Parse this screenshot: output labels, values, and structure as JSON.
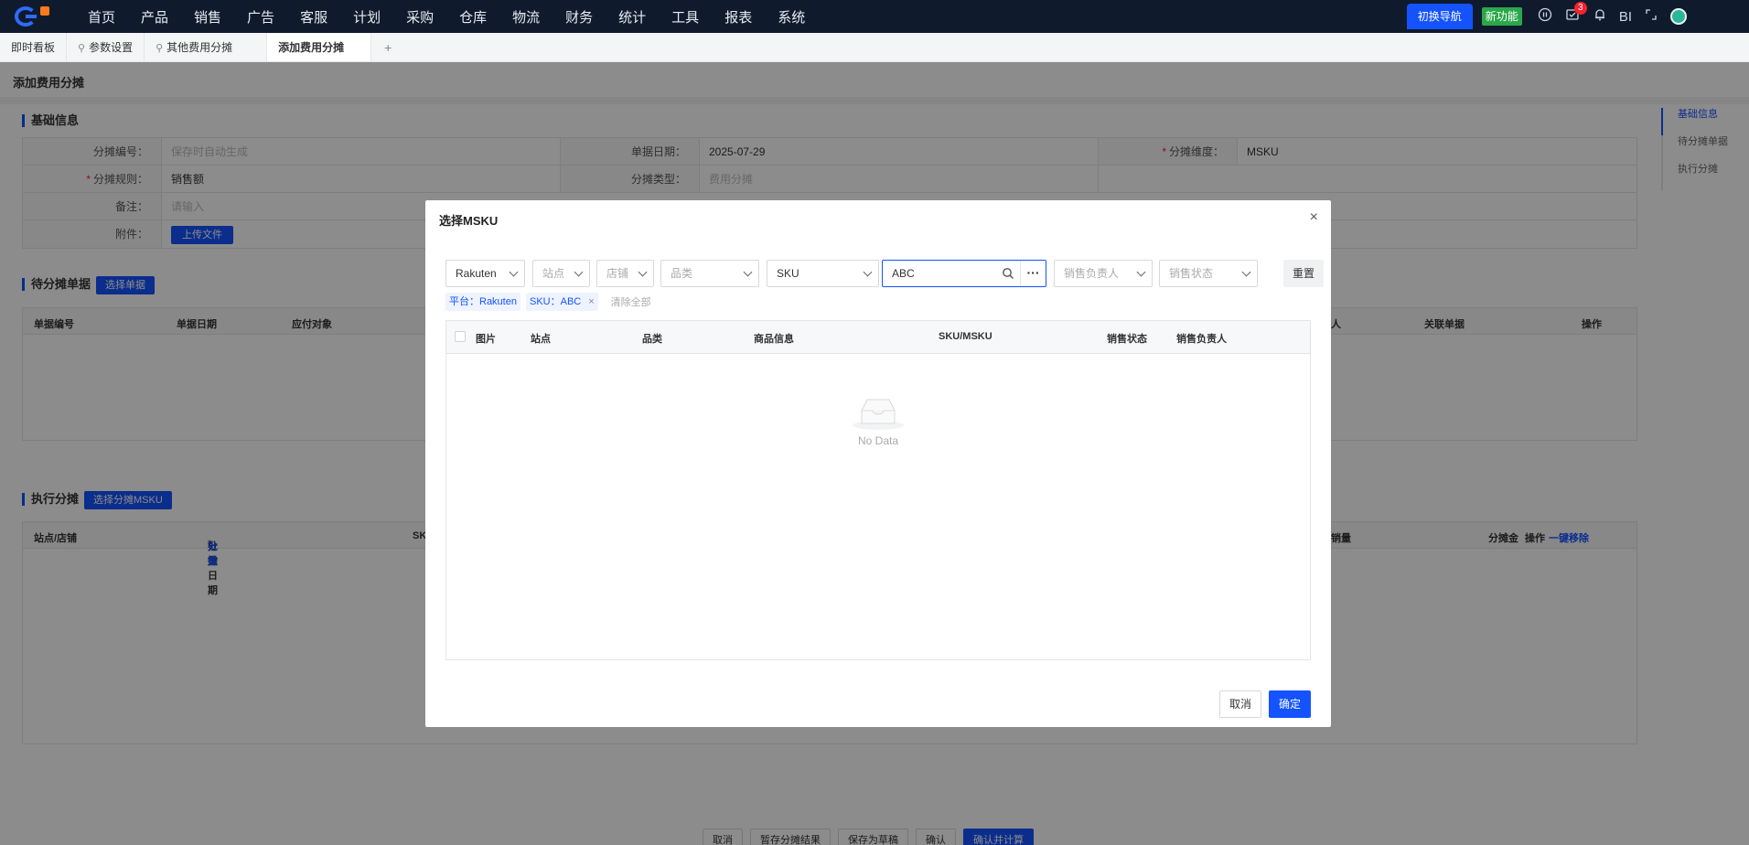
{
  "nav": {
    "menu": [
      "首页",
      "产品",
      "销售",
      "广告",
      "客服",
      "计划",
      "采购",
      "仓库",
      "物流",
      "财务",
      "统计",
      "工具",
      "报表",
      "系统"
    ],
    "switch_nav": "初换导航",
    "new_feature": "新功能",
    "notif_count": "3",
    "bi": "BI"
  },
  "tabs": [
    {
      "label": "即时看板"
    },
    {
      "label": "参数设置"
    },
    {
      "label": "其他费用分摊"
    },
    {
      "label": "添加费用分摊"
    }
  ],
  "page": {
    "title": "添加费用分摊",
    "basic": {
      "title": "基础信息",
      "row1": {
        "l1": "分摊编号：",
        "v1": "保存时自动生成",
        "l2": "单据日期：",
        "v2": "2025-07-29",
        "l3": "分摊维度：",
        "v3": "MSKU"
      },
      "row2": {
        "l1": "分摊规则：",
        "v1": "销售额",
        "l2": "分摊类型：",
        "v2": "费用分摊"
      },
      "row3": {
        "l1": "备注：",
        "v1": "请输入"
      },
      "row4": {
        "l1": "附件：",
        "upload": "上传文件"
      }
    },
    "pending": {
      "title": "待分摊单据",
      "button": "选择单据",
      "columns": [
        "单据编号",
        "单据日期",
        "应付对象",
        "人",
        "关联单据",
        "操作"
      ]
    },
    "execute": {
      "title": "执行分摊",
      "button": "选择分摊MSKU",
      "columns": [
        "站点/店铺",
        "分摊日期",
        "批量",
        "SK",
        "销量",
        "分摊金",
        "操作",
        "一键移除"
      ]
    },
    "anchors": [
      "基础信息",
      "待分摊单据",
      "执行分摊"
    ],
    "footer": [
      "取消",
      "暂存分摊结果",
      "保存为草稿",
      "确认",
      "确认并计算"
    ]
  },
  "modal": {
    "title": "选择MSKU",
    "filters": {
      "platform": "Rakuten",
      "site": "站点",
      "shop": "店铺",
      "category": "品类",
      "search_type": "SKU",
      "search_value": "ABC",
      "sales_owner": "销售负责人",
      "sales_status": "销售状态",
      "reset": "重置"
    },
    "tags": [
      {
        "label": "平台：Rakuten",
        "closable": false
      },
      {
        "label": "SKU：ABC",
        "closable": true
      }
    ],
    "clear_all": "清除全部",
    "columns": [
      "图片",
      "站点",
      "品类",
      "商品信息",
      "SKU/MSKU",
      "销售状态",
      "销售负责人"
    ],
    "empty_text": "No Data",
    "cancel": "取消",
    "confirm": "确定"
  },
  "colors": {
    "primary": "#1453ff",
    "nav_bg": "#0f1b2d",
    "success": "#2ba84a",
    "danger": "#f5222d"
  }
}
